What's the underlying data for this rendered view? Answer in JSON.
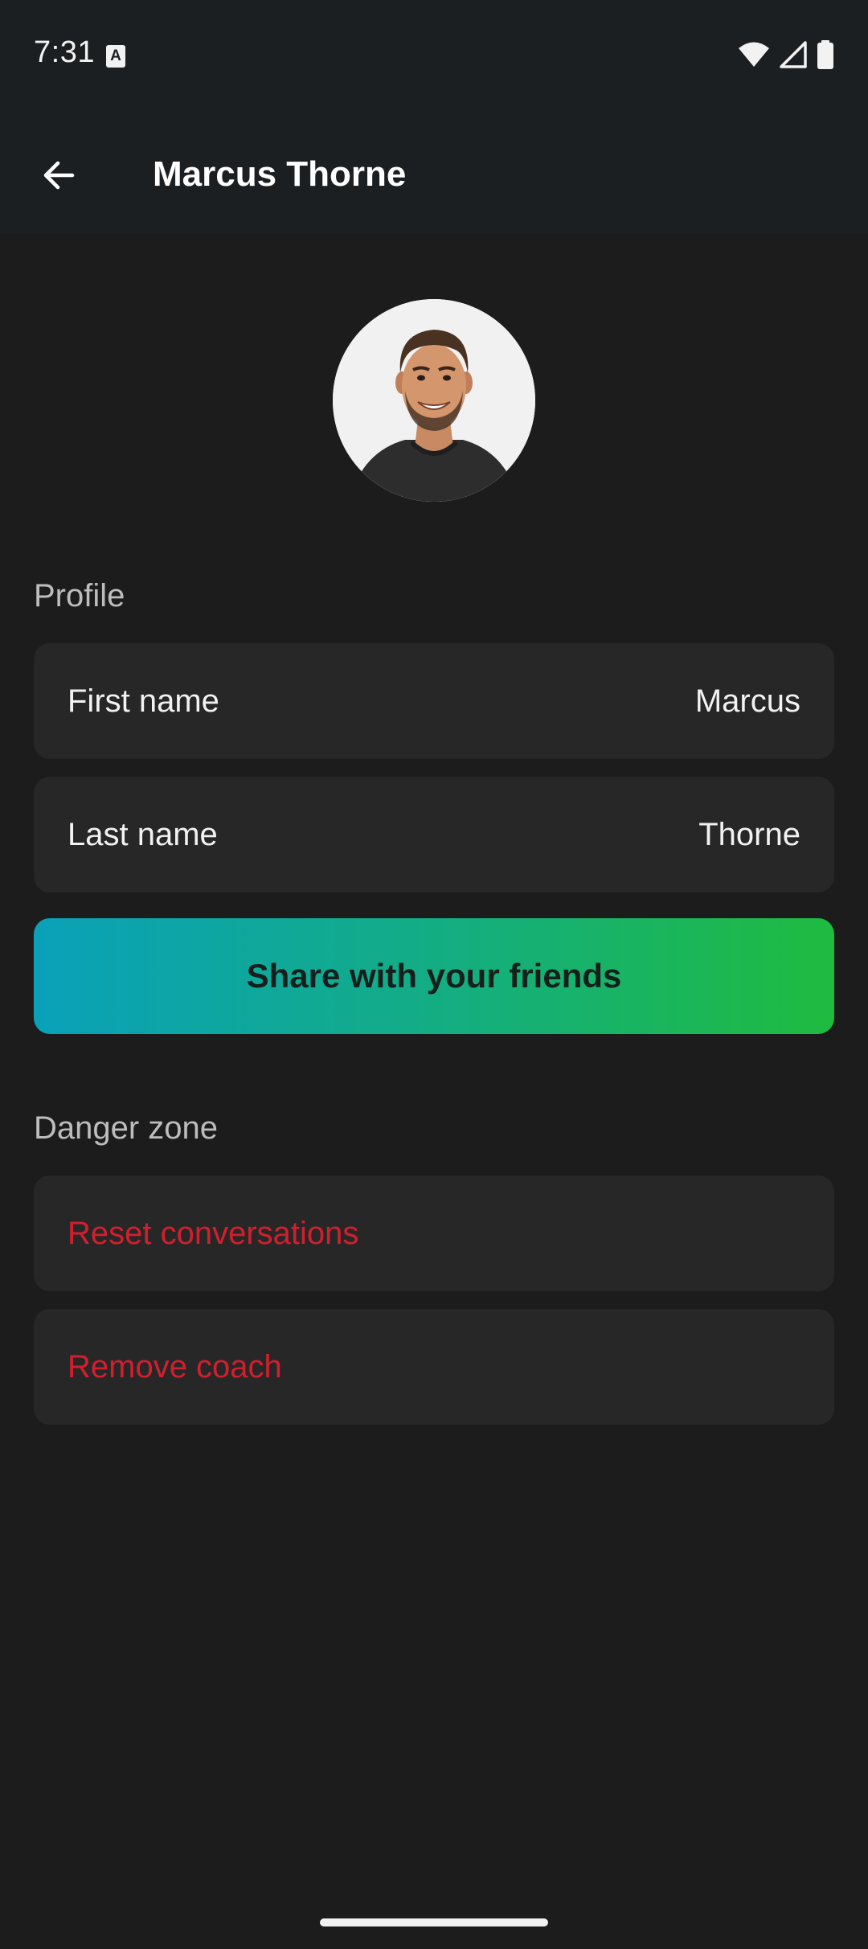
{
  "status_bar": {
    "time": "7:31",
    "notification_icon": "a-icon",
    "icons": [
      "wifi-icon",
      "signal-icon",
      "battery-icon"
    ]
  },
  "app_bar": {
    "back_icon": "arrow-left-icon",
    "title": "Marcus Thorne"
  },
  "avatar": {
    "icon": "avatar-photo"
  },
  "profile": {
    "section_label": "Profile",
    "first_name_label": "First name",
    "first_name_value": "Marcus",
    "last_name_label": "Last name",
    "last_name_value": "Thorne"
  },
  "share": {
    "label": "Share with your friends",
    "gradient": [
      "#0aa1b9",
      "#1fbb3f"
    ]
  },
  "danger": {
    "section_label": "Danger zone",
    "reset_label": "Reset conversations",
    "remove_label": "Remove coach",
    "color": "#d21f2e"
  },
  "colors": {
    "background": "#1c1c1c",
    "card": "#272727",
    "app_bar": "#1c1f21"
  }
}
